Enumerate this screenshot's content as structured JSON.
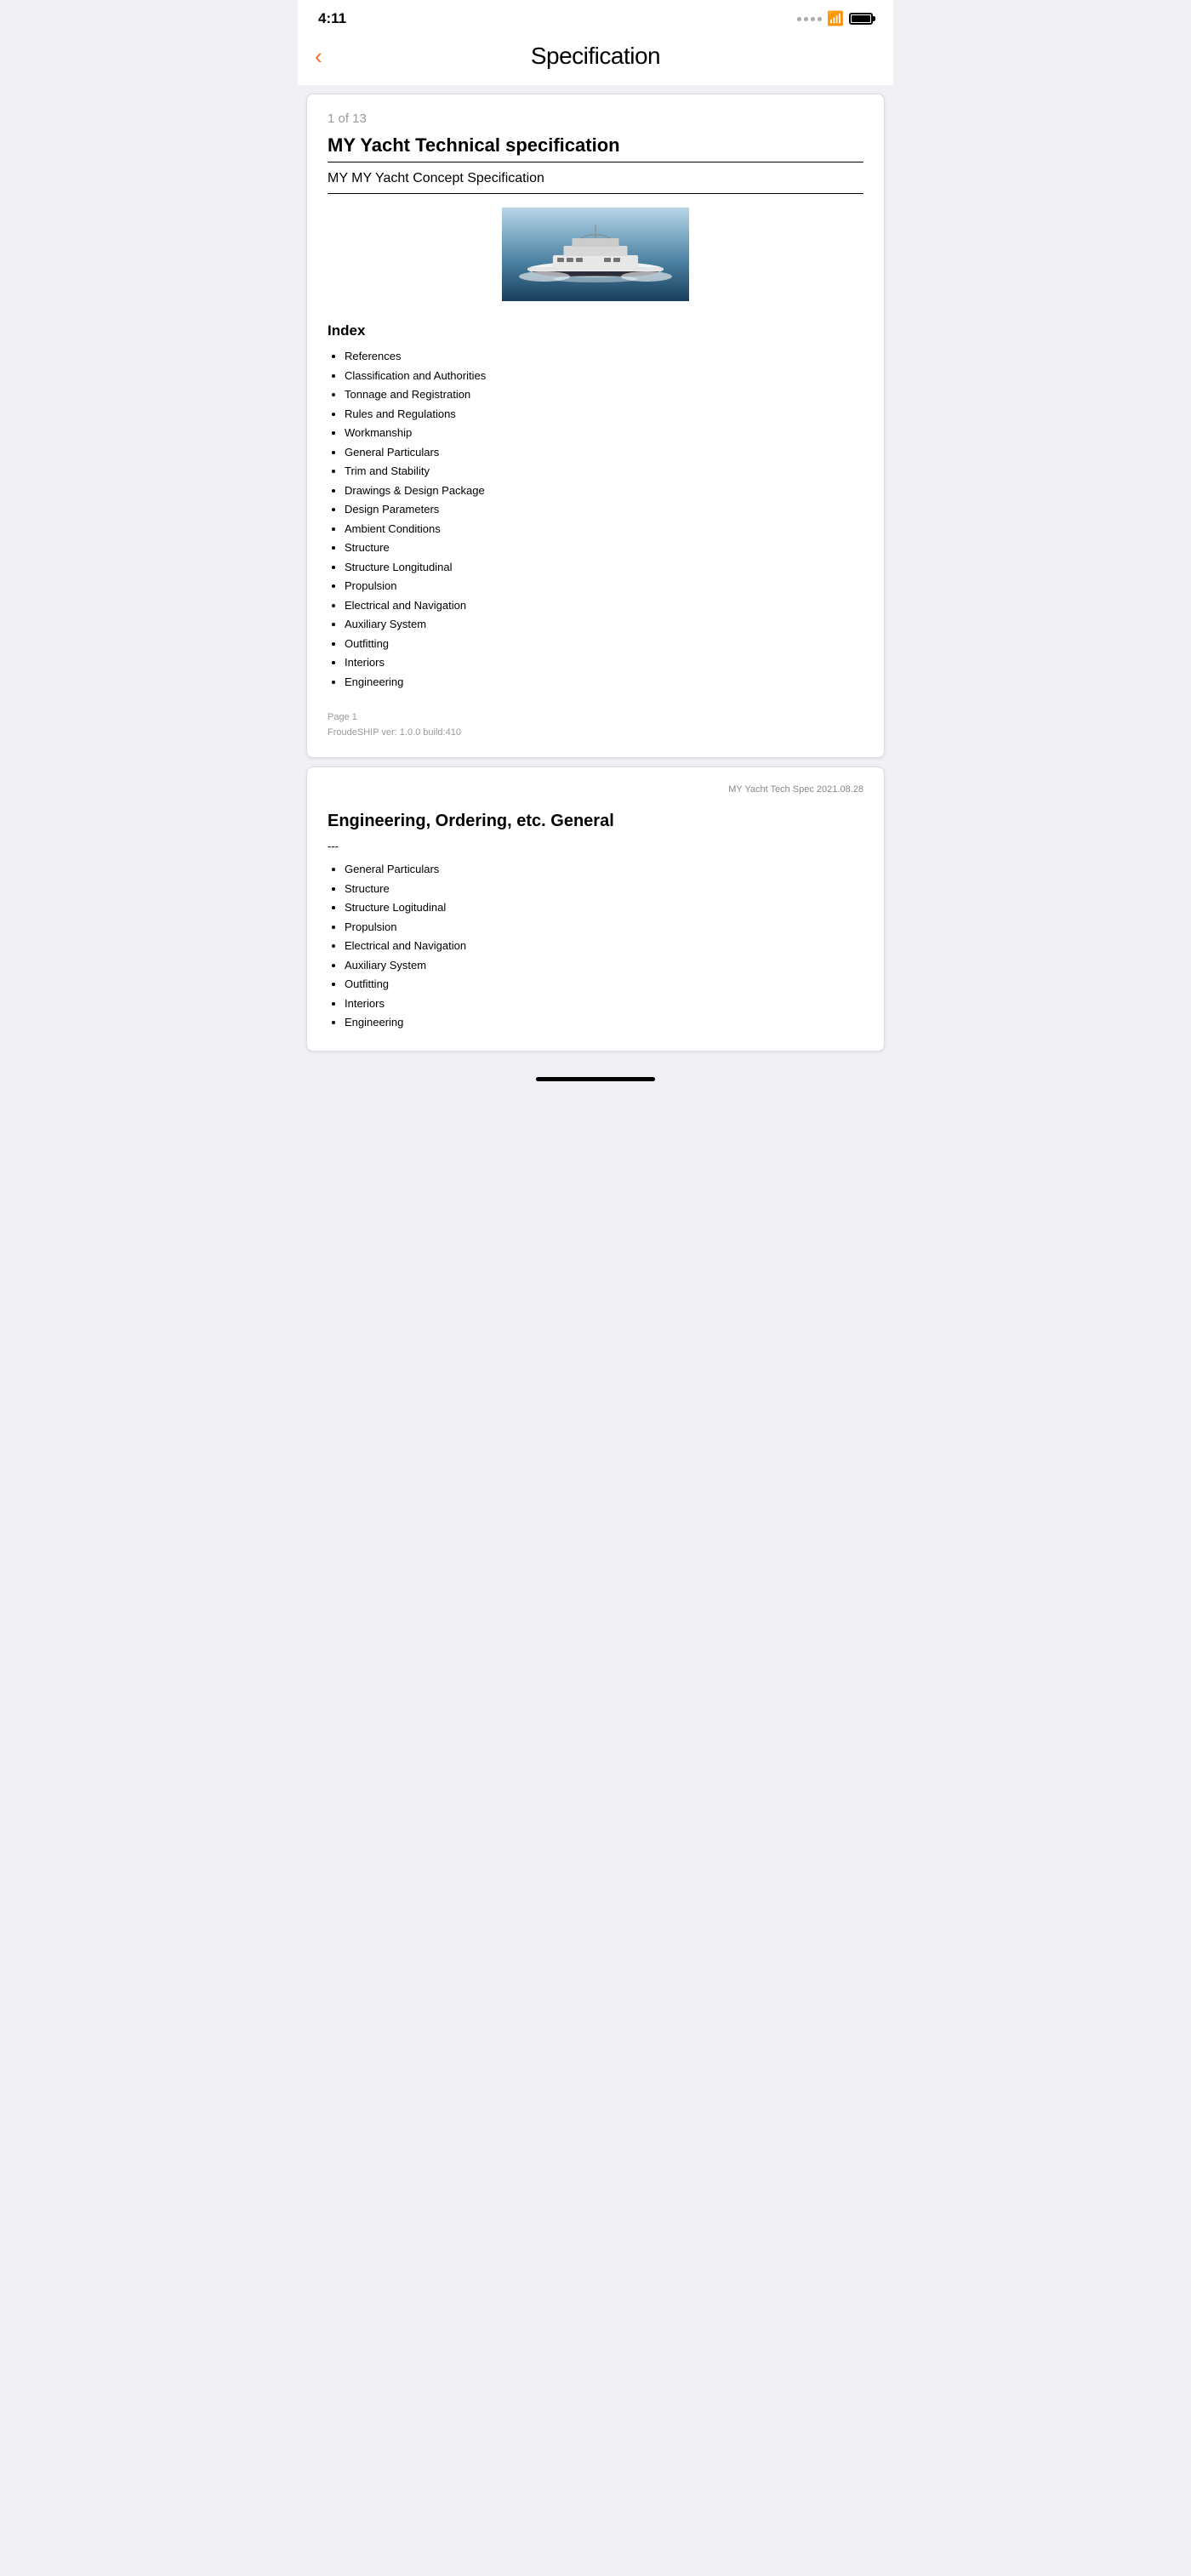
{
  "statusBar": {
    "time": "4:11",
    "battery_label": "battery"
  },
  "header": {
    "back_label": "‹",
    "title": "Specification"
  },
  "page1": {
    "page_indicator": "1 of 13",
    "doc_title_main": "MY Yacht Technical specification",
    "doc_title_sub": "MY MY Yacht Concept Specification",
    "index_title": "Index",
    "index_items": [
      "References",
      "Classification and Authorities",
      "Tonnage and Registration",
      "Rules and Regulations",
      "Workmanship",
      "General Particulars",
      "Trim and Stability",
      "Drawings & Design Package",
      "Design Parameters",
      "Ambient Conditions",
      "Structure",
      "Structure Longitudinal",
      "Propulsion",
      "Electrical and Navigation",
      "Auxiliary System",
      "Outfitting",
      "Interiors",
      "Engineering"
    ],
    "footer_page": "Page 1",
    "footer_version": "FroudeSHIP ver: 1.0.0 build:410"
  },
  "page2": {
    "doc_header": "MY Yacht Tech Spec 2021.08.28",
    "section_title": "Engineering, Ordering, etc. General",
    "section_dash": "---",
    "list_items": [
      "General Particulars",
      "Structure",
      "Structure Logitudinal",
      "Propulsion",
      "Electrical and Navigation",
      "Auxiliary System",
      "Outfitting",
      "Interiors",
      "Engineering"
    ]
  }
}
